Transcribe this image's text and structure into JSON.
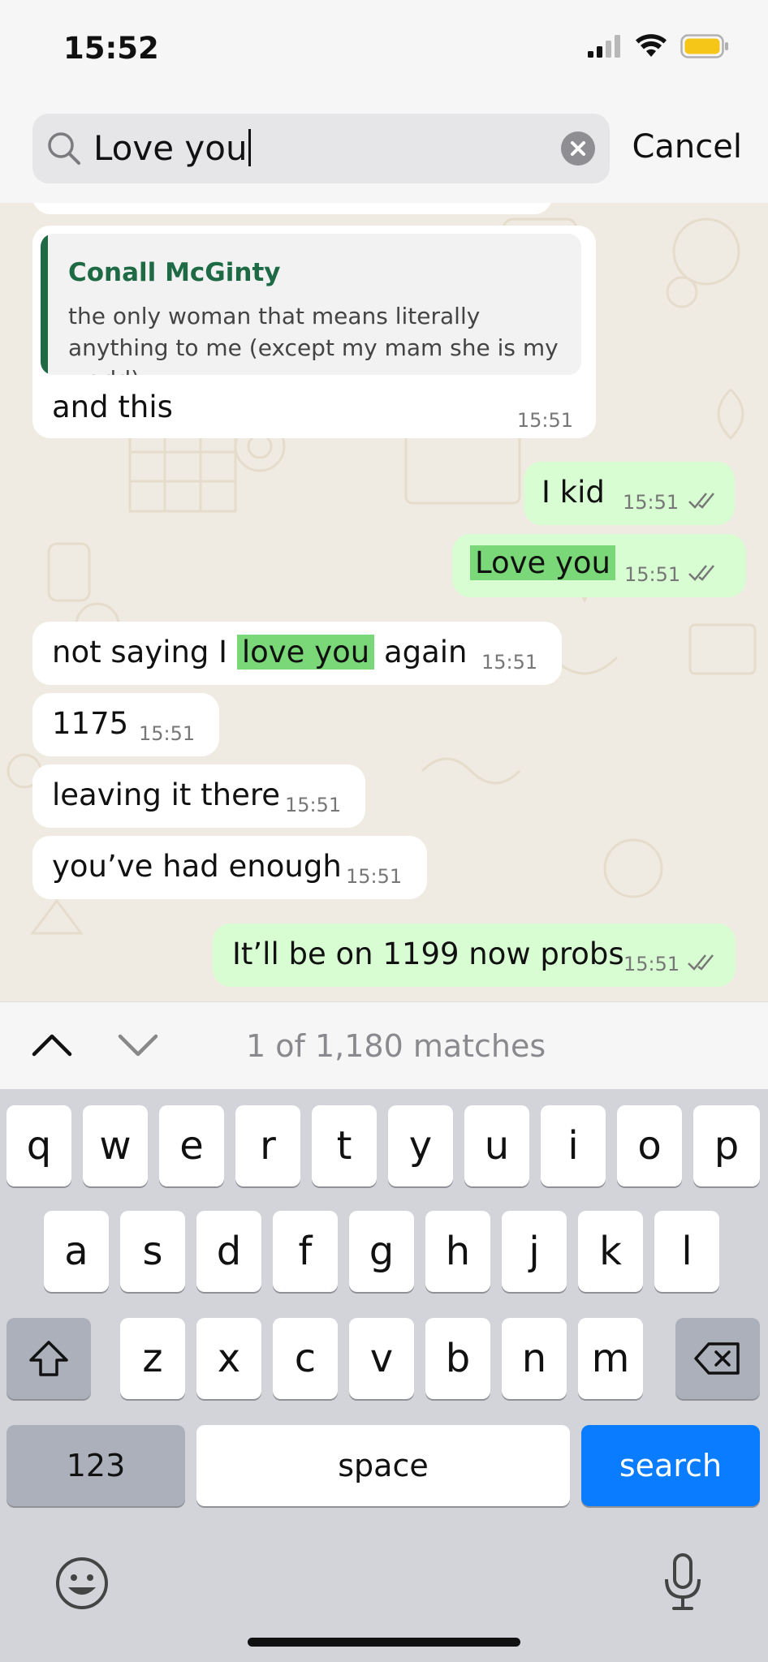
{
  "status": {
    "time": "15:52"
  },
  "search": {
    "value": "Love you",
    "cancel_label": "Cancel"
  },
  "messages": [
    {
      "type": "in",
      "reply": {
        "name": "Conall McGinty",
        "text": "the only woman that means literally anything to me (except my mam she is my world)"
      },
      "text": "and this",
      "time": "15:51"
    },
    {
      "type": "out",
      "text": "I kid",
      "time": "15:51"
    },
    {
      "type": "out",
      "text": "Love you",
      "time": "15:51"
    },
    {
      "type": "in",
      "text_before": "not saying I ",
      "text_highlight": "love you",
      "text_after": " again",
      "time": "15:51"
    },
    {
      "type": "in",
      "text": "1175",
      "time": "15:51"
    },
    {
      "type": "in",
      "text": "leaving it there",
      "time": "15:51"
    },
    {
      "type": "in",
      "text": "you’ve had enough",
      "time": "15:51"
    },
    {
      "type": "out",
      "text": "It’ll be on 1199 now probs",
      "time": "15:51"
    }
  ],
  "match_bar": {
    "count_text": "1 of 1,180 matches"
  },
  "keyboard": {
    "row1": [
      "q",
      "w",
      "e",
      "r",
      "t",
      "y",
      "u",
      "i",
      "o",
      "p"
    ],
    "row2": [
      "a",
      "s",
      "d",
      "f",
      "g",
      "h",
      "j",
      "k",
      "l"
    ],
    "row3": [
      "z",
      "x",
      "c",
      "v",
      "b",
      "n",
      "m"
    ],
    "numbers_label": "123",
    "space_label": "space",
    "search_label": "search"
  },
  "colors": {
    "accent": "#0a7cff",
    "outgoing_bubble": "#d8fdd2",
    "highlight": "#7ad878",
    "quote_name": "#1d6a45"
  }
}
